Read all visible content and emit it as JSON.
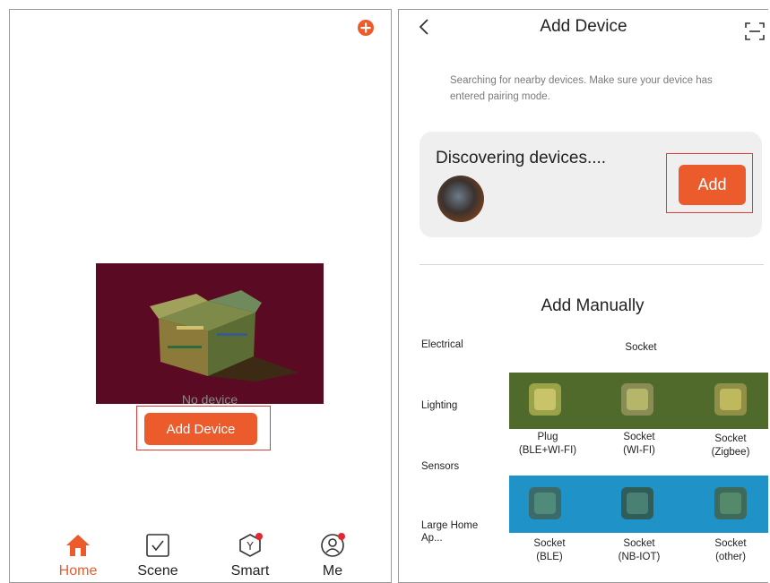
{
  "home": {
    "empty_text": "No device",
    "add_device_label": "Add Device",
    "tabs": [
      {
        "label": "Home",
        "icon": "home-icon",
        "active": true
      },
      {
        "label": "Scene",
        "icon": "scene-checkbox-icon",
        "active": false
      },
      {
        "label": "Smart",
        "icon": "smart-shield-icon",
        "active": false,
        "badge": true
      },
      {
        "label": "Me",
        "icon": "profile-icon",
        "active": false,
        "badge": true
      }
    ]
  },
  "add_device": {
    "title": "Add Device",
    "search_hint": "Searching for nearby devices. Make sure your device has entered pairing mode.",
    "discover_title": "Discovering devices....",
    "add_label": "Add",
    "manual_title": "Add Manually",
    "categories": [
      "Electrical",
      "Lighting",
      "Sensors",
      "Large Home Ap..."
    ],
    "socket_heading": "Socket",
    "devices": [
      {
        "name": "Plug",
        "sub": "(BLE+WI-FI)"
      },
      {
        "name": "Socket",
        "sub": "(WI-FI)"
      },
      {
        "name": "Socket",
        "sub": "(Zigbee)"
      },
      {
        "name": "Socket",
        "sub": "(BLE)"
      },
      {
        "name": "Socket",
        "sub": "(NB-IOT)"
      },
      {
        "name": "Socket",
        "sub": "(other)"
      }
    ]
  },
  "colors": {
    "accent": "#ec5b2b",
    "highlight": "#e03a3a",
    "badge": "#e5262f"
  }
}
